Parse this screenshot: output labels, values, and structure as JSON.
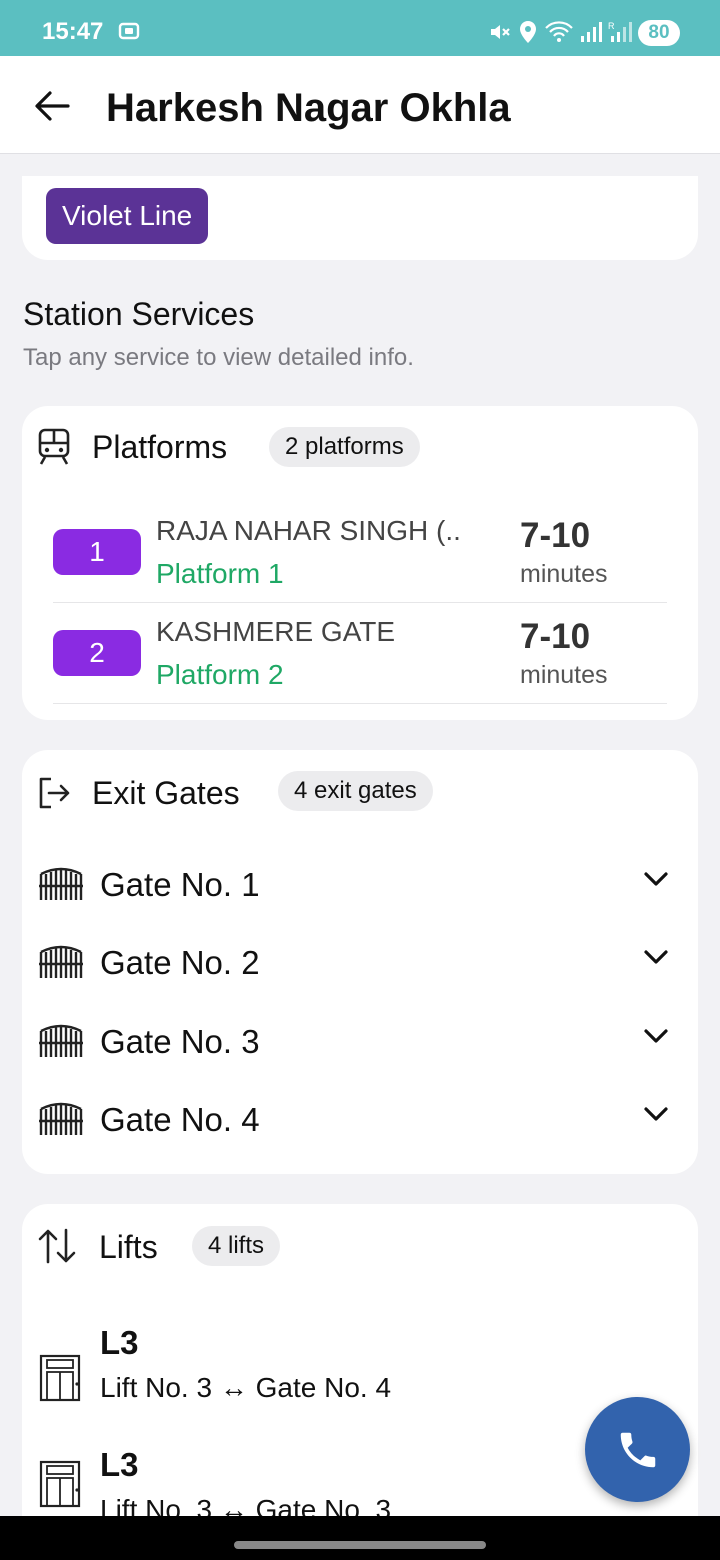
{
  "status_bar": {
    "time": "15:47",
    "battery": "80",
    "icons": [
      "screen-record-icon",
      "mute-icon",
      "location-icon",
      "wifi-icon",
      "signal-icon",
      "signal-roaming-icon"
    ]
  },
  "app_bar": {
    "title": "Harkesh Nagar Okhla",
    "back_icon": "arrow-left-icon"
  },
  "line": {
    "label": "Violet Line",
    "color": "#5b3396"
  },
  "services": {
    "title": "Station Services",
    "subtitle": "Tap any service to view detailed info."
  },
  "platforms": {
    "title": "Platforms",
    "count": "2 platforms",
    "icon": "train-icon",
    "items": [
      {
        "number": "1",
        "destination": "RAJA NAHAR SINGH (..",
        "platform": "Platform 1",
        "time": "7-10",
        "unit": "minutes"
      },
      {
        "number": "2",
        "destination": "KASHMERE GATE",
        "platform": "Platform 2",
        "time": "7-10",
        "unit": "minutes"
      }
    ]
  },
  "exit_gates": {
    "title": "Exit Gates",
    "count": "4 exit gates",
    "icon": "exit-icon",
    "items": [
      {
        "label": "Gate No. 1"
      },
      {
        "label": "Gate No. 2"
      },
      {
        "label": "Gate No. 3"
      },
      {
        "label": "Gate No. 4"
      }
    ]
  },
  "lifts": {
    "title": "Lifts",
    "count": "4 lifts",
    "icon": "up-down-arrows-icon",
    "items": [
      {
        "code": "L3",
        "description": "Lift No. 3 ↔ Gate No. 4"
      },
      {
        "code": "L3",
        "description": "Lift No. 3 ↔ Gate No. 3"
      }
    ]
  },
  "colors": {
    "status_bar": "#5bbfc1",
    "platform_badge": "#8a2be2",
    "platform_text": "#1fa865",
    "fab": "#3263ad"
  },
  "fab": {
    "icon": "phone-icon"
  }
}
